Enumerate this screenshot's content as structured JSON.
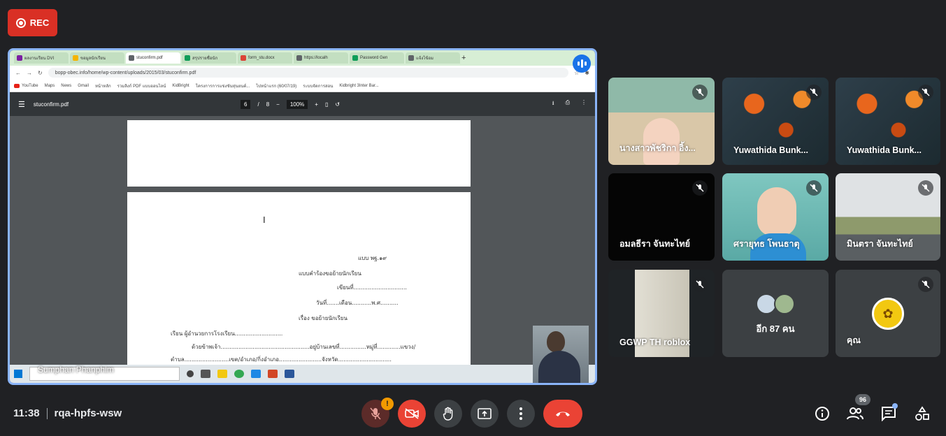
{
  "rec": {
    "label": "REC"
  },
  "browser": {
    "tabs": [
      "ผลงานเรียน DVI",
      "ขอมูลนักเรียน",
      "stuconfirm.pdf",
      "สรุปรายชื่อนัก",
      "form_stu.docx",
      "https://localh",
      "Password Gen",
      "แจ้งไข้อม"
    ],
    "url": "bopp-obec.info/home/wp-content/uploads/2015/03/stuconfirm.pdf",
    "bookmarks": [
      "YouTube",
      "Maps",
      "News",
      "Gmail",
      "หน้าหลัก",
      "รวมลิงก์ PDF แบบออนไลน์",
      "KidBright",
      "โครงการการแข่งขันหุ่นยนต์...",
      "ไปหน้าแรก (60/07/19)",
      "ระบบจัดการสอน",
      "Kidbright 3Inter Bar..."
    ]
  },
  "pdf": {
    "filename": "stuconfirm.pdf",
    "page_current": "6",
    "page_total": "8",
    "zoom": "100%",
    "lines": [
      "แบบ พฐ.๑๙",
      "แบบคำร้องขอย้ายนักเรียน",
      "เขียนที่..............................",
      "วันที่.......เดือน...........พ.ศ..........",
      "เรื่อง  ขอย้ายนักเรียน",
      "เรียน  ผู้อำนวยการโรงเรียน...........................",
      "ด้วยข้าพเจ้า..................................................อยู่บ้านเลขที่...............หมู่ที่.............แขวง/",
      "ตำบล.........................เขต/อำเภอ/กิ่งอำเภอ........................จังหวัด.............................."
    ]
  },
  "presenter": {
    "name": "Sumphan Phanphim"
  },
  "participants": [
    {
      "name": "นางสาวพัชริกา อิ้ง..."
    },
    {
      "name": "Yuwathida Bunk..."
    },
    {
      "name": "Yuwathida Bunk..."
    },
    {
      "name": "อมลธีรา จันทะไทย์"
    },
    {
      "name": "ศรายุทธ โพนธาตุ"
    },
    {
      "name": "มินตรา จันทะไทย์"
    },
    {
      "name": "GGWP TH roblox"
    },
    {
      "name": "อีก 87 คน"
    },
    {
      "name": "คุณ"
    }
  ],
  "meeting": {
    "time": "11:38",
    "code": "rqa-hpfs-wsw"
  },
  "people_count": "96",
  "mic_warning": "!",
  "colors": {
    "accent": "#8ab4f8",
    "end_call": "#ea4335",
    "rec": "#d93025"
  }
}
